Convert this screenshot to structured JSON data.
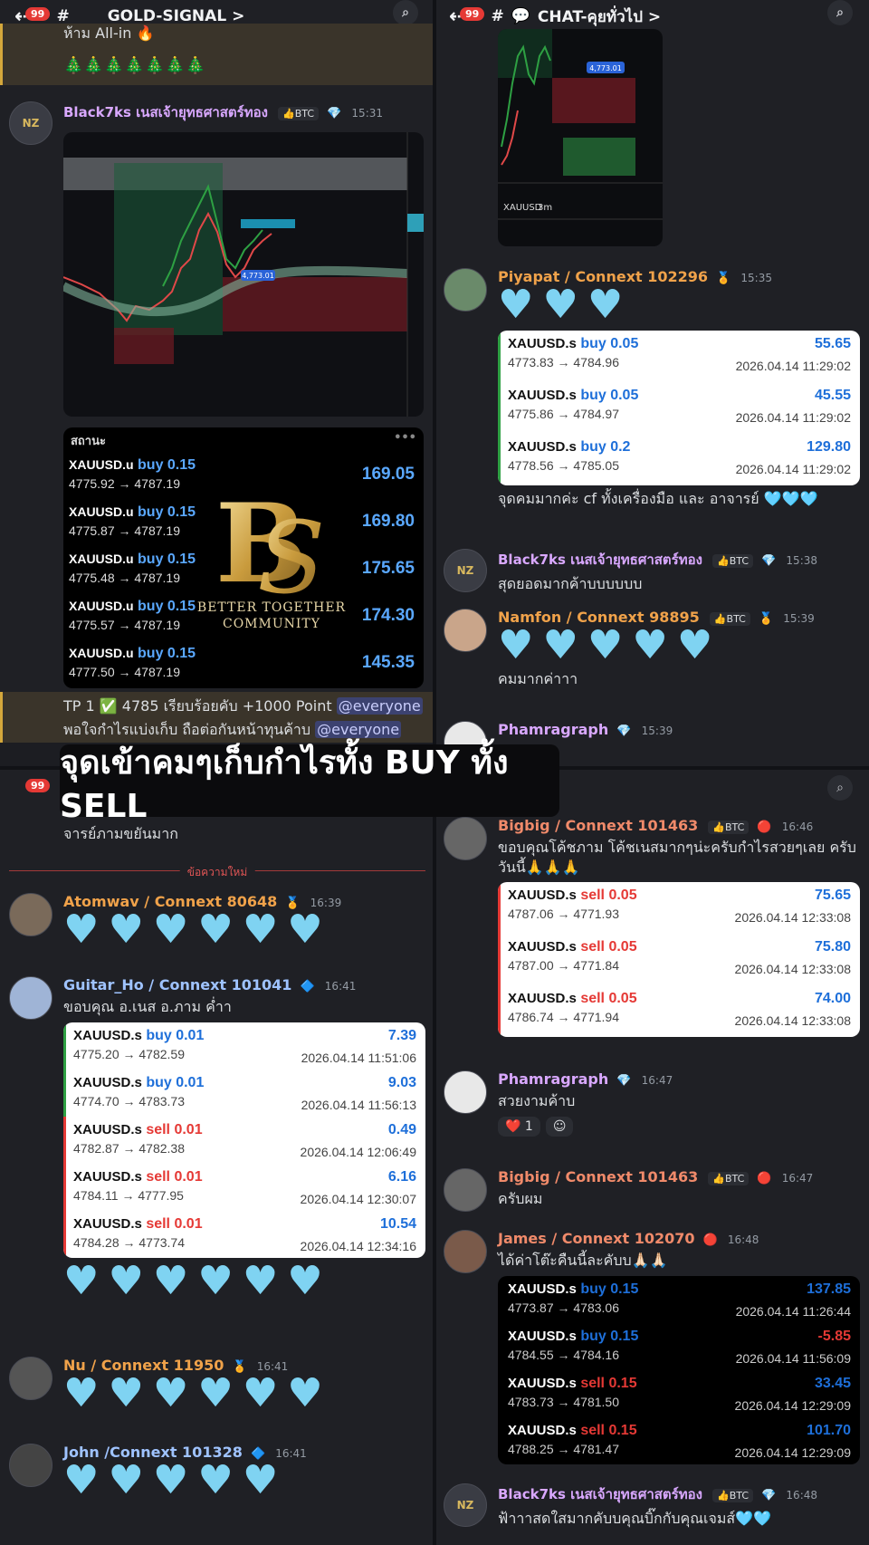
{
  "overlay_caption": "จุดเข้าคมๆเก็บกำไรทั้ง BUY ทั้ง SELL",
  "top_left": {
    "channel": "GOLD-SIGNAL >",
    "badge": "99",
    "top_text": "ห้าม All-in 🔥",
    "trees": "🎄🎄🎄🎄🎄🎄🎄",
    "msg1": {
      "user": "Black7ks เนสเจ้ายุทธศาสตร์ทอง",
      "tag": "👍BTC",
      "time": "15:31"
    },
    "chart_label_1": "4,773.01",
    "status": {
      "header": "สถานะ",
      "rows": [
        {
          "sym": "XAUUSD.u",
          "side": "buy 0.15",
          "prices": "4775.92 → 4787.19",
          "profit": "169.05"
        },
        {
          "sym": "XAUUSD.u",
          "side": "buy 0.15",
          "prices": "4775.87 → 4787.19",
          "profit": "169.80"
        },
        {
          "sym": "XAUUSD.u",
          "side": "buy 0.15",
          "prices": "4775.48 → 4787.19",
          "profit": "175.65"
        },
        {
          "sym": "XAUUSD.u",
          "side": "buy 0.15",
          "prices": "4775.57 → 4787.19",
          "profit": "174.30"
        },
        {
          "sym": "XAUUSD.u",
          "side": "buy 0.15",
          "prices": "4777.50 → 4787.19",
          "profit": "145.35"
        }
      ],
      "logo_line1": "BETTER TOGETHER",
      "logo_line2": "COMMUNITY"
    },
    "tp_line1": "TP 1 ✅ 4785 เรียบร้อยคับ +1000 Point",
    "tp_line2": "พอใจกำไรแบ่งเก็บ ถือต่อกันหน้าทุนค้าบ",
    "mention": "@everyone"
  },
  "top_right": {
    "channel": "CHAT-คุยทั่วไป >",
    "badge": "99",
    "chart_symbol": "XAUUSD",
    "chart_tf": "3m",
    "chart_label": "4,773.01",
    "msg_piyapat": {
      "user": "Piyapat / Connext 102296",
      "time": "15:35",
      "hearts": 3
    },
    "trades1": [
      {
        "sym": "XAUUSD.s",
        "side": "buy 0.05",
        "prices": "4773.83 → 4784.96",
        "profit": "55.65",
        "dt": "2026.04.14 11:29:02"
      },
      {
        "sym": "XAUUSD.s",
        "side": "buy 0.05",
        "prices": "4775.86 → 4784.97",
        "profit": "45.55",
        "dt": "2026.04.14 11:29:02"
      },
      {
        "sym": "XAUUSD.s",
        "side": "buy 0.2",
        "prices": "4778.56 → 4785.05",
        "profit": "129.80",
        "dt": "2026.04.14 11:29:02"
      }
    ],
    "piyapat_text": "จุดคมมากค่ะ cf ทั้งเครื่องมือ และ อาจารย์ 🩵🩵🩵",
    "msg_black": {
      "user": "Black7ks เนสเจ้ายุทธศาสตร์ทอง",
      "tag": "👍BTC",
      "time": "15:38",
      "text": "สุดยอดมากค้าบบบบบบ"
    },
    "msg_namfon": {
      "user": "Namfon / Connext 98895",
      "tag": "👍BTC",
      "time": "15:39",
      "hearts": 5,
      "text": "คมมากค่าาา"
    },
    "msg_pham": {
      "user": "Phamragraph",
      "time": "15:39"
    }
  },
  "bottom_left": {
    "badge": "99",
    "prev_text": "จารย์ภามขยันมาก",
    "new_messages": "ข้อความใหม่",
    "msg_atom": {
      "user": "Atomwav / Connext 80648",
      "time": "16:39",
      "hearts": 6
    },
    "msg_guitar": {
      "user": "Guitar_Ho / Connext 101041",
      "time": "16:41",
      "text": "ขอบคุณ อ.เนส อ.ภาม ค่ำา"
    },
    "trades": [
      {
        "sym": "XAUUSD.s",
        "side": "buy 0.01",
        "type": "buy",
        "prices": "4775.20 → 4782.59",
        "profit": "7.39",
        "dt": "2026.04.14 11:51:06"
      },
      {
        "sym": "XAUUSD.s",
        "side": "buy 0.01",
        "type": "buy",
        "prices": "4774.70 → 4783.73",
        "profit": "9.03",
        "dt": "2026.04.14 11:56:13"
      },
      {
        "sym": "XAUUSD.s",
        "side": "sell 0.01",
        "type": "sell",
        "prices": "4782.87 → 4782.38",
        "profit": "0.49",
        "dt": "2026.04.14 12:06:49"
      },
      {
        "sym": "XAUUSD.s",
        "side": "sell 0.01",
        "type": "sell",
        "prices": "4784.11 → 4777.95",
        "profit": "6.16",
        "dt": "2026.04.14 12:30:07"
      },
      {
        "sym": "XAUUSD.s",
        "side": "sell 0.01",
        "type": "sell",
        "prices": "4784.28 → 4773.74",
        "profit": "10.54",
        "dt": "2026.04.14 12:34:16"
      }
    ],
    "guitar_hearts": 6,
    "msg_nu": {
      "user": "Nu / Connext 11950",
      "time": "16:41",
      "hearts": 6
    },
    "msg_john": {
      "user": "John /Connext 101328",
      "time": "16:41",
      "hearts": 5
    }
  },
  "bottom_right": {
    "channel": "CHAT-คุยทั่วไป >",
    "msg_bigbig": {
      "user": "Bigbig / Connext 101463",
      "tag": "👍BTC",
      "time": "16:46",
      "text": "ขอบคุณโค้ชภาม โค้ชเนสมากๆน่ะครับกำไรสวยๆเลย ครับวันนี้🙏🙏🙏"
    },
    "trades": [
      {
        "sym": "XAUUSD.s",
        "side": "sell 0.05",
        "prices": "4787.06 → 4771.93",
        "profit": "75.65",
        "dt": "2026.04.14 12:33:08"
      },
      {
        "sym": "XAUUSD.s",
        "side": "sell 0.05",
        "prices": "4787.00 → 4771.84",
        "profit": "75.80",
        "dt": "2026.04.14 12:33:08"
      },
      {
        "sym": "XAUUSD.s",
        "side": "sell 0.05",
        "prices": "4786.74 → 4771.94",
        "profit": "74.00",
        "dt": "2026.04.14 12:33:08"
      }
    ],
    "msg_pham": {
      "user": "Phamragraph",
      "time": "16:47",
      "text": "สวยงามค้าบ",
      "reaction_count": "1"
    },
    "msg_bigbig2": {
      "user": "Bigbig / Connext 101463",
      "tag": "👍BTC",
      "time": "16:47",
      "text": "ครับผม"
    },
    "msg_james": {
      "user": "James / Connext 102070",
      "time": "16:48",
      "text": "ได้ค่าโต๊ะคืนนี้ละคับบ🙏🏻🙏🏻"
    },
    "james_trades": [
      {
        "sym": "XAUUSD.s",
        "side": "buy 0.15",
        "type": "buy",
        "prices": "4773.87 → 4783.06",
        "profit": "137.85",
        "dt": "2026.04.14 11:26:44"
      },
      {
        "sym": "XAUUSD.s",
        "side": "buy 0.15",
        "type": "buy",
        "prices": "4784.55 → 4784.16",
        "profit": "-5.85",
        "dt": "2026.04.14 11:56:09"
      },
      {
        "sym": "XAUUSD.s",
        "side": "sell 0.15",
        "type": "sell",
        "prices": "4783.73 → 4781.50",
        "profit": "33.45",
        "dt": "2026.04.14 12:29:09"
      },
      {
        "sym": "XAUUSD.s",
        "side": "sell 0.15",
        "type": "sell",
        "prices": "4788.25 → 4781.47",
        "profit": "101.70",
        "dt": "2026.04.14 12:29:09"
      }
    ],
    "msg_black": {
      "user": "Black7ks เนสเจ้ายุทธศาสตร์ทอง",
      "tag": "👍BTC",
      "time": "16:48",
      "text": "ฟ้าาาสดใสมากคับบคุณบิ๊กกับคุณเจมส์🩵🩵"
    }
  }
}
